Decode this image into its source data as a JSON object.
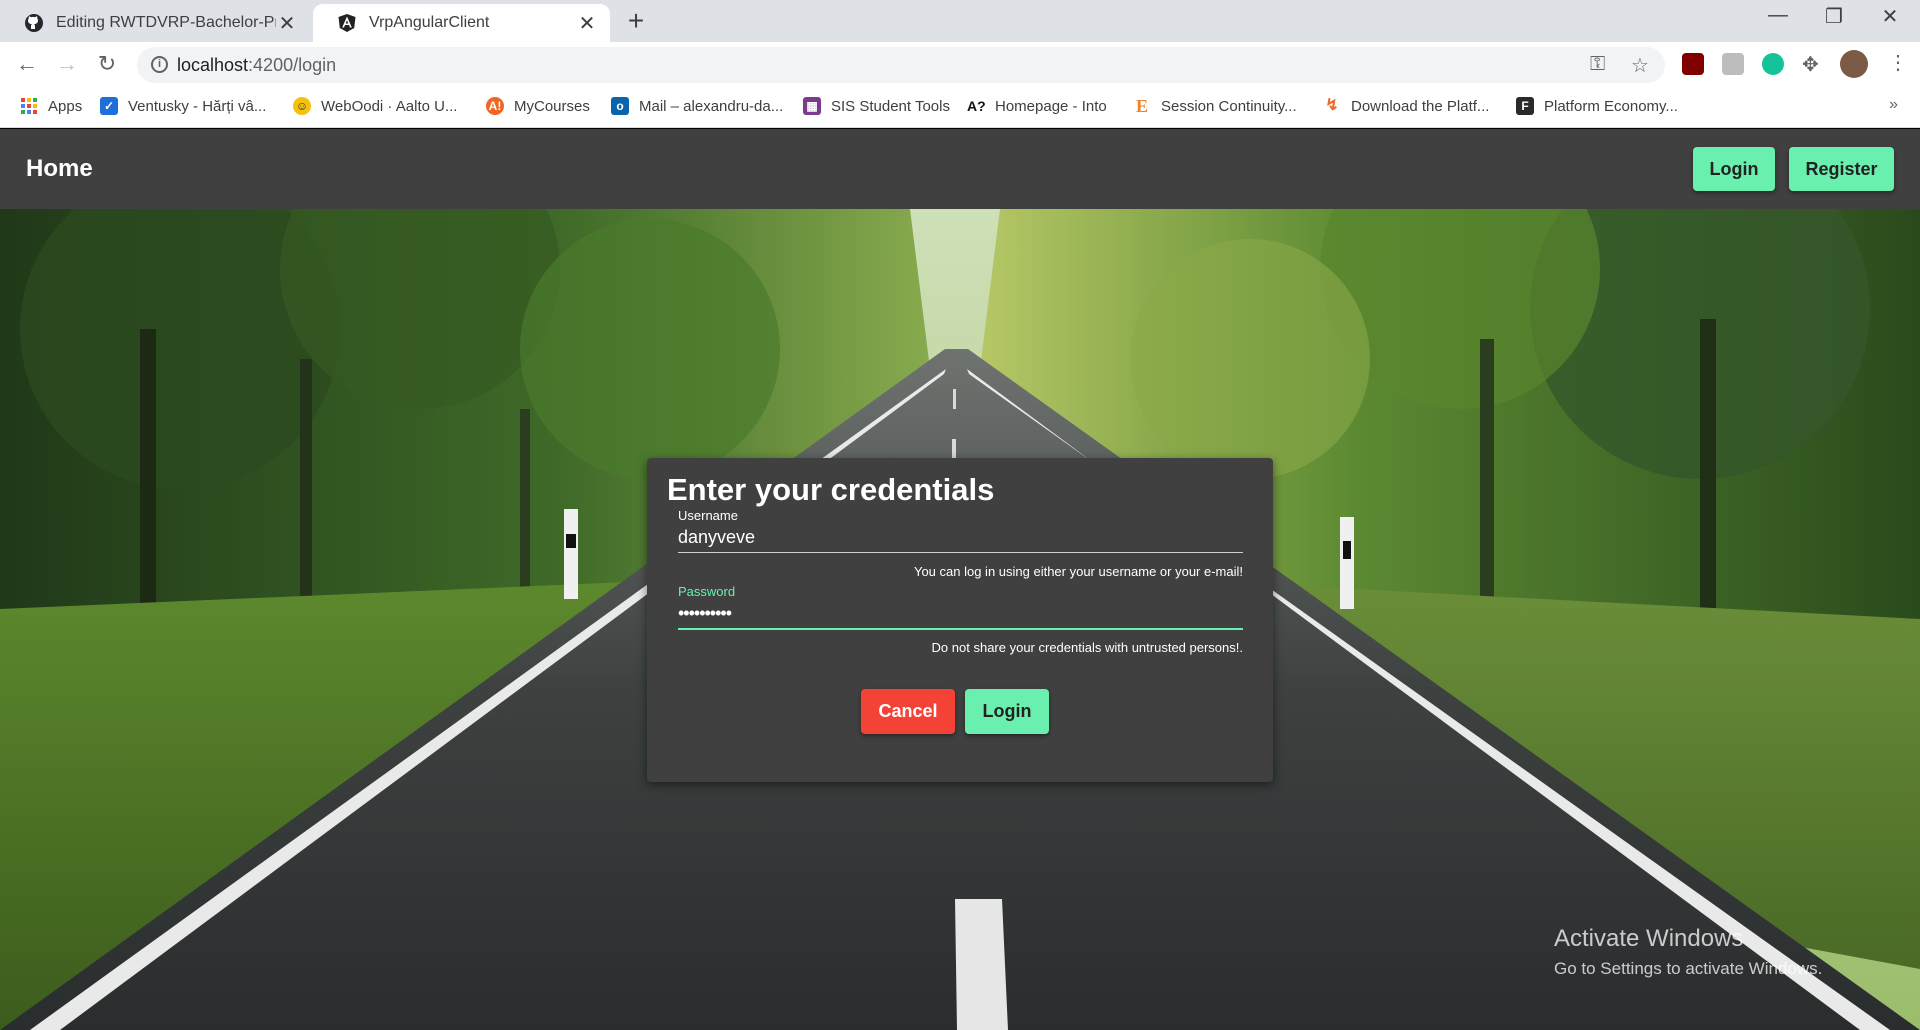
{
  "browser": {
    "tabs": [
      {
        "title": "Editing RWTDVRP-Bachelor-Proje",
        "active": false,
        "icon": "github-icon"
      },
      {
        "title": "VrpAngularClient",
        "active": true,
        "icon": "angular-icon"
      }
    ],
    "url_host": "localhost",
    "url_path": ":4200/login",
    "bookmarks": [
      {
        "label": "Apps",
        "icon": "apps-grid-icon",
        "color": "#ea4335"
      },
      {
        "label": "Ventusky - Hărți vâ...",
        "icon": "ventusky-icon",
        "color": "#1e6fd9"
      },
      {
        "label": "WebOodi · Aalto U...",
        "icon": "weboodi-icon",
        "color": "#f4c20d"
      },
      {
        "label": "MyCourses",
        "icon": "mycourses-icon",
        "color": "#f26522"
      },
      {
        "label": "Mail – alexandru-da...",
        "icon": "outlook-icon",
        "color": "#0a64ad"
      },
      {
        "label": "SIS Student Tools",
        "icon": "sis-icon",
        "color": "#7a3b8f"
      },
      {
        "label": "Homepage - Into",
        "icon": "aalto-icon",
        "color": "#111111"
      },
      {
        "label": "Session Continuity...",
        "icon": "e-icon",
        "color": "#f48024"
      },
      {
        "label": "Download the Platf...",
        "icon": "platform-icon",
        "color": "#f26522"
      },
      {
        "label": "Platform Economy...",
        "icon": "f-icon",
        "color": "#2a2a2a"
      }
    ]
  },
  "app": {
    "home_label": "Home",
    "nav_login_label": "Login",
    "nav_register_label": "Register",
    "accent_color": "#69f0ae",
    "warn_color": "#f44336",
    "card": {
      "title": "Enter your credentials",
      "username_label": "Username",
      "username_value": "danyveve",
      "username_hint": "You can log in using either your username or your e-mail!",
      "password_label": "Password",
      "password_value": "••••••••••",
      "password_hint": "Do not share your credentials with untrusted persons!.",
      "cancel_label": "Cancel",
      "login_label": "Login"
    }
  },
  "os_watermark": {
    "line1": "Activate Windows",
    "line2": "Go to Settings to activate Windows."
  }
}
